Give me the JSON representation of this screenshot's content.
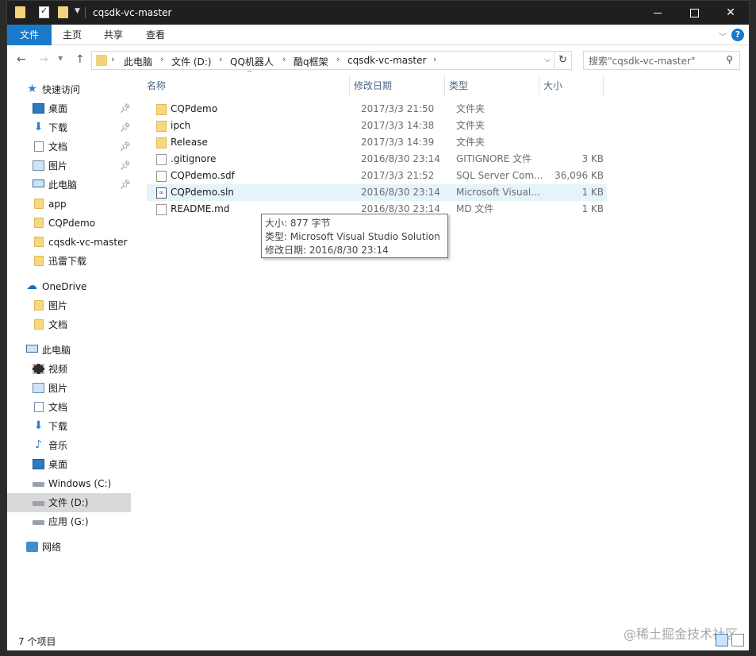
{
  "window": {
    "title": "cqsdk-vc-master"
  },
  "ribbon": {
    "tabs": [
      {
        "label": "文件"
      },
      {
        "label": "主页"
      },
      {
        "label": "共享"
      },
      {
        "label": "查看"
      }
    ],
    "help_label": "?"
  },
  "nav": {
    "breadcrumb": [
      "此电脑",
      "文件 (D:)",
      "QQ机器人",
      "酷q框架",
      "cqsdk-vc-master"
    ],
    "search_placeholder": "搜索\"cqsdk-vc-master\""
  },
  "sidebar": {
    "items": [
      {
        "label": "快速访问",
        "icon": "star-icon"
      },
      {
        "label": "桌面",
        "icon": "desktop-icon",
        "pinned": true
      },
      {
        "label": "下载",
        "icon": "download-icon",
        "pinned": true
      },
      {
        "label": "文档",
        "icon": "document-icon",
        "pinned": true
      },
      {
        "label": "图片",
        "icon": "picture-icon",
        "pinned": true
      },
      {
        "label": "此电脑",
        "icon": "computer-icon",
        "pinned": true
      },
      {
        "label": "app",
        "icon": "folder-icon"
      },
      {
        "label": "CQPdemo",
        "icon": "folder-icon"
      },
      {
        "label": "cqsdk-vc-master",
        "icon": "folder-icon"
      },
      {
        "label": "迅雷下载",
        "icon": "folder-icon"
      },
      {
        "label": "OneDrive",
        "icon": "cloud-icon"
      },
      {
        "label": "图片",
        "icon": "folder-icon"
      },
      {
        "label": "文档",
        "icon": "folder-icon"
      },
      {
        "label": "此电脑",
        "icon": "computer-icon"
      },
      {
        "label": "视频",
        "icon": "video-icon"
      },
      {
        "label": "图片",
        "icon": "picture-icon"
      },
      {
        "label": "文档",
        "icon": "document-icon"
      },
      {
        "label": "下载",
        "icon": "download-icon"
      },
      {
        "label": "音乐",
        "icon": "music-icon"
      },
      {
        "label": "桌面",
        "icon": "desktop-icon"
      },
      {
        "label": "Windows (C:)",
        "icon": "drive-icon"
      },
      {
        "label": "文件 (D:)",
        "icon": "drive-icon",
        "selected": true
      },
      {
        "label": "应用 (G:)",
        "icon": "drive-icon"
      },
      {
        "label": "网络",
        "icon": "network-icon"
      }
    ]
  },
  "columns": {
    "name": "名称",
    "date": "修改日期",
    "type": "类型",
    "size": "大小"
  },
  "files": [
    {
      "name": "CQPdemo",
      "date": "2017/3/3 21:50",
      "type": "文件夹",
      "size": "",
      "icon": "folder-icon"
    },
    {
      "name": "ipch",
      "date": "2017/3/3 14:38",
      "type": "文件夹",
      "size": "",
      "icon": "folder-icon"
    },
    {
      "name": "Release",
      "date": "2017/3/3 14:39",
      "type": "文件夹",
      "size": "",
      "icon": "folder-icon"
    },
    {
      "name": ".gitignore",
      "date": "2016/8/30 23:14",
      "type": "GITIGNORE 文件",
      "size": "3 KB",
      "icon": "file-icon"
    },
    {
      "name": "CQPdemo.sdf",
      "date": "2017/3/3 21:52",
      "type": "SQL Server Com...",
      "size": "36,096 KB",
      "icon": "sdf-file-icon"
    },
    {
      "name": "CQPdemo.sln",
      "date": "2016/8/30 23:14",
      "type": "Microsoft Visual...",
      "size": "1 KB",
      "icon": "sln-file-icon",
      "hover": true
    },
    {
      "name": "README.md",
      "date": "2016/8/30 23:14",
      "type": "MD 文件",
      "size": "1 KB",
      "icon": "file-icon"
    }
  ],
  "tooltip": {
    "line1": "大小: 877 字节",
    "line2": "类型: Microsoft Visual Studio Solution",
    "line3": "修改日期: 2016/8/30 23:14"
  },
  "status": {
    "item_count": "7 个项目",
    "watermark": "@稀土掘金技术社区"
  }
}
